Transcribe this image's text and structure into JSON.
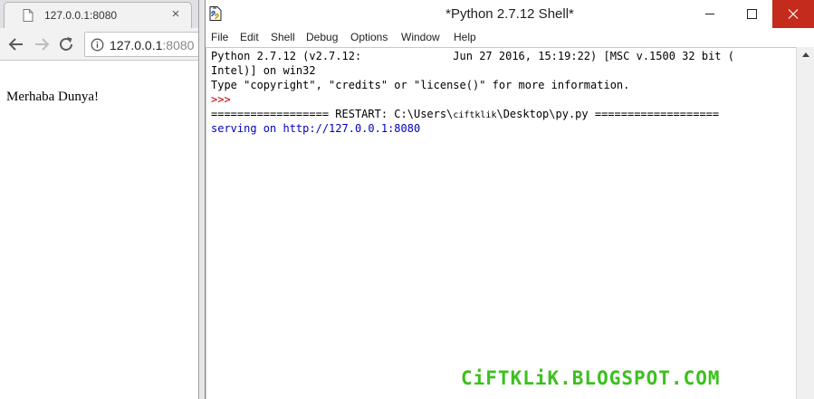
{
  "browser": {
    "tab": {
      "title": "127.0.0.1:8080",
      "close_glyph": "×",
      "icon": "file-icon"
    },
    "nav": {
      "back_icon": "back-arrow-icon",
      "forward_icon": "forward-arrow-icon",
      "reload_icon": "reload-icon"
    },
    "omnibox": {
      "info_icon": "info-icon",
      "host": "127.0.0.1",
      "port": ":8080"
    },
    "page": {
      "text": "Merhaba Dunya!"
    }
  },
  "idle": {
    "title": "*Python 2.7.12 Shell*",
    "app_icon": "python-idle-icon",
    "window_buttons": {
      "minimize": "minimize-icon",
      "maximize": "maximize-icon",
      "close": "close-icon",
      "close_color": "#c42b1c"
    },
    "menu": [
      "File",
      "Edit",
      "Shell",
      "Debug",
      "Options",
      "Window",
      "Help"
    ],
    "lines": {
      "l1": "Python 2.7.12 (v2.7.12:              Jun 27 2016, 15:19:22) [MSC v.1500 32 bit (",
      "l2": "Intel)] on win32",
      "l3": "Type \"copyright\", \"credits\" or \"license()\" for more information.",
      "l4": ">>>",
      "l5_pre": "================== RESTART: C:\\Users\\",
      "l5_user": "ciftklik",
      "l5_post": "\\Desktop\\py.py ===================",
      "l6": "serving on http://127.0.0.1:8080"
    },
    "colors": {
      "prompt": "#c00000",
      "output": "#0000c0"
    }
  },
  "watermark": "CiFTKLiK.BLOGSPOT.COM"
}
